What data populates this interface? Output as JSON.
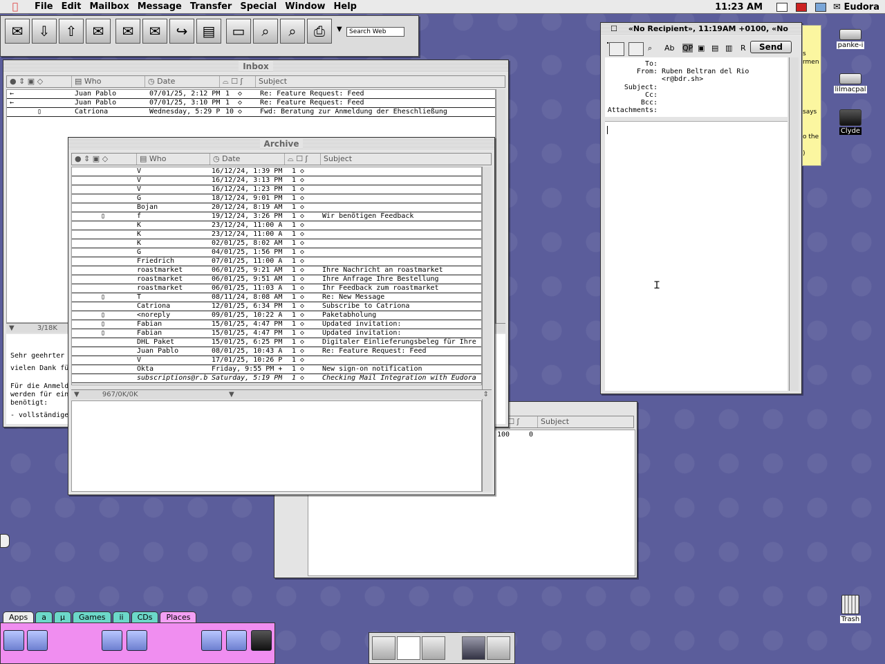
{
  "menubar": {
    "items": [
      "File",
      "Edit",
      "Mailbox",
      "Message",
      "Transfer",
      "Special",
      "Window",
      "Help"
    ],
    "clock": "11:23 AM",
    "app_name": "Eudora"
  },
  "toolbar": {
    "search_placeholder": "Search Web"
  },
  "inbox": {
    "title": "Inbox",
    "columns": [
      "Who",
      "Date",
      "Subject"
    ],
    "rows": [
      {
        "who": "Juan Pablo",
        "date": "07/01/25, 2:12 PM",
        "pri": "1",
        "subject": "Re: Feature Request: Feed"
      },
      {
        "who": "Juan Pablo",
        "date": "07/01/25, 3:10 PM",
        "pri": "1",
        "subject": "Re: Feature Request: Feed"
      },
      {
        "who": "Catriona",
        "date": "Wednesday, 5:29 P",
        "pri": "10",
        "subject": "Fwd: Beratung zur Anmeldung der Eheschließung"
      }
    ],
    "status": "3/18K",
    "preview_lines": [
      "Sehr geehrter",
      "vielen Dank fü",
      "Für die Anmeld",
      "werden für ein",
      "benötigt:",
      "- vollständige"
    ]
  },
  "archive": {
    "title": "Archive",
    "columns": [
      "Who",
      "Date",
      "Subject"
    ],
    "rows": [
      {
        "who": "V",
        "date": "16/12/24, 1:39 PM",
        "pri": "1",
        "subject": "",
        "attach": false,
        "italic": false
      },
      {
        "who": "V",
        "date": "16/12/24, 3:13 PM",
        "pri": "1",
        "subject": "",
        "attach": false,
        "italic": false
      },
      {
        "who": "V",
        "date": "16/12/24, 1:23 PM",
        "pri": "1",
        "subject": "",
        "attach": false,
        "italic": false
      },
      {
        "who": "G",
        "date": "18/12/24, 9:01 PM",
        "pri": "1",
        "subject": "",
        "attach": false,
        "italic": false
      },
      {
        "who": "Bojan",
        "date": "20/12/24, 8:19 AM",
        "pri": "1",
        "subject": "",
        "attach": false,
        "italic": false
      },
      {
        "who": "f",
        "date": "19/12/24, 3:26 PM",
        "pri": "1",
        "subject": "Wir benötigen Feedback",
        "attach": true,
        "italic": false
      },
      {
        "who": "K",
        "date": "23/12/24, 11:00 A",
        "pri": "1",
        "subject": "",
        "attach": false,
        "italic": false
      },
      {
        "who": "K",
        "date": "23/12/24, 11:00 A",
        "pri": "1",
        "subject": "",
        "attach": false,
        "italic": false
      },
      {
        "who": "K",
        "date": "02/01/25, 8:02 AM",
        "pri": "1",
        "subject": "",
        "attach": false,
        "italic": false
      },
      {
        "who": "G",
        "date": "04/01/25, 1:56 PM",
        "pri": "1",
        "subject": "",
        "attach": false,
        "italic": false
      },
      {
        "who": "Friedrich",
        "date": "07/01/25, 11:00 A",
        "pri": "1",
        "subject": "",
        "attach": false,
        "italic": false
      },
      {
        "who": "roastmarket",
        "date": "06/01/25, 9:21 AM",
        "pri": "1",
        "subject": "Ihre Nachricht an roastmarket",
        "attach": false,
        "italic": false
      },
      {
        "who": "roastmarket",
        "date": "06/01/25, 9:51 AM",
        "pri": "1",
        "subject": "Ihre Anfrage Ihre Bestellung",
        "attach": false,
        "italic": false
      },
      {
        "who": "roastmarket",
        "date": "06/01/25, 11:03 A",
        "pri": "1",
        "subject": "Ihr Feedback zum roastmarket",
        "attach": false,
        "italic": false
      },
      {
        "who": "T",
        "date": "08/11/24, 8:08 AM",
        "pri": "1",
        "subject": "Re: New Message",
        "attach": true,
        "italic": false
      },
      {
        "who": "Catriona",
        "date": "12/01/25, 6:34 PM",
        "pri": "1",
        "subject": "Subscribe to Catriona",
        "attach": false,
        "italic": false
      },
      {
        "who": "<noreply",
        "date": "09/01/25, 10:22 A",
        "pri": "1",
        "subject": "Paketabholung",
        "attach": true,
        "italic": false
      },
      {
        "who": "Fabian",
        "date": "15/01/25, 4:47 PM",
        "pri": "1",
        "subject": "Updated invitation:",
        "attach": true,
        "italic": false
      },
      {
        "who": "Fabian",
        "date": "15/01/25, 4:47 PM",
        "pri": "1",
        "subject": "Updated invitation:",
        "attach": true,
        "italic": false
      },
      {
        "who": "DHL Paket",
        "date": "15/01/25, 6:25 PM",
        "pri": "1",
        "subject": "Digitaler Einlieferungsbeleg für Ihre",
        "attach": false,
        "italic": false
      },
      {
        "who": "Juan Pablo",
        "date": "08/01/25, 10:43 A",
        "pri": "1",
        "subject": "Re: Feature Request: Feed",
        "attach": false,
        "italic": false
      },
      {
        "who": "V",
        "date": "17/01/25, 10:26 P",
        "pri": "1",
        "subject": "",
        "attach": false,
        "italic": false
      },
      {
        "who": "Okta",
        "date": "Friday, 9:55 PM +",
        "pri": "1",
        "subject": "New sign-on notification",
        "attach": false,
        "italic": false
      },
      {
        "who": "subscriptions@r.b",
        "date": "Saturday, 5:19 PM",
        "pri": "1",
        "subject": "Checking Mail Integration with Eudora",
        "attach": false,
        "italic": true
      }
    ],
    "status": "967/0K/0K"
  },
  "back_window": {
    "columns": [
      "Subject"
    ],
    "row_fragment_left": "100",
    "row_fragment_right": "0"
  },
  "compose": {
    "title": "«No Recipient», 11:19AM +0100, «No ...",
    "send_label": "Send",
    "fields": [
      {
        "label": "To:",
        "value": ""
      },
      {
        "label": "From:",
        "value": "Ruben Beltran del Rio"
      },
      {
        "label": "",
        "value": "<r@bdr.sh>"
      },
      {
        "label": "Subject:",
        "value": ""
      },
      {
        "label": "Cc:",
        "value": ""
      },
      {
        "label": "Bcc:",
        "value": ""
      },
      {
        "label": "Attachments:",
        "value": ""
      }
    ],
    "toolbar_buttons": [
      "Ab",
      "QP",
      "R"
    ]
  },
  "sticky_note": {
    "lines": [
      "s",
      "rmen",
      "says",
      "o the",
      ")"
    ]
  },
  "desktop_icons": [
    {
      "name": "panke-i",
      "inverted": false
    },
    {
      "name": "lilmacpal",
      "inverted": false
    },
    {
      "name": "Clyde",
      "inverted": true
    },
    {
      "name": "Trash",
      "inverted": false
    }
  ],
  "launcher": {
    "tabs": [
      "Apps",
      "a",
      "µ",
      "Games",
      "ii",
      "CDs",
      "Places"
    ],
    "active_tab": "Places"
  }
}
